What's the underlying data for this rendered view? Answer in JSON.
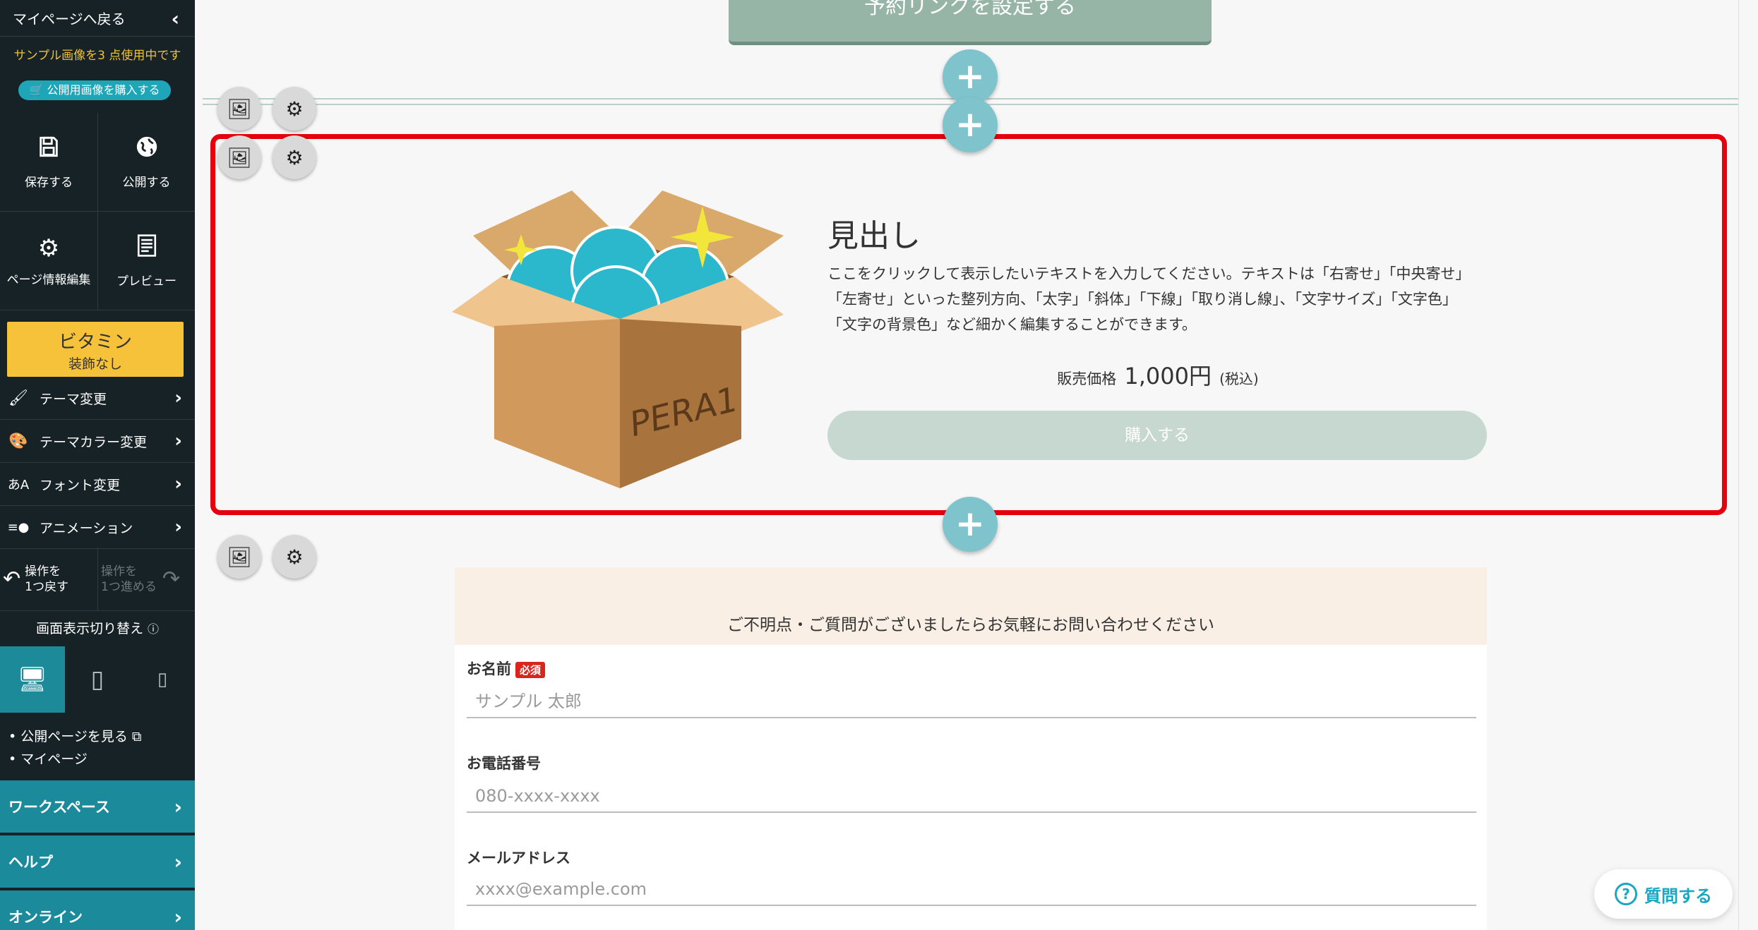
{
  "sidebar": {
    "back_label": "マイページへ戻る",
    "sample_notice": "サンプル画像を3 点使用中です",
    "buy_images_label": "公開用画像を購入する",
    "actions": [
      {
        "label": "保存する",
        "icon": "save-icon"
      },
      {
        "label": "公開する",
        "icon": "globe-icon"
      },
      {
        "label": "ページ情報編集",
        "icon": "gear-icon"
      },
      {
        "label": "プレビュー",
        "icon": "preview-icon"
      }
    ],
    "theme": {
      "name": "ビタミン",
      "sub": "装飾なし"
    },
    "menu": [
      {
        "label": "テーマ変更",
        "icon": "paint-roller-icon"
      },
      {
        "label": "テーマカラー変更",
        "icon": "palette-icon"
      },
      {
        "label": "フォント変更",
        "icon": "font-icon"
      },
      {
        "label": "アニメーション",
        "icon": "animation-icon"
      }
    ],
    "undo": {
      "line1": "操作を",
      "line2": "1つ戻す"
    },
    "redo": {
      "line1": "操作を",
      "line2": "1つ進める"
    },
    "view_switch_label": "画面表示切り替え",
    "links": [
      "公開ページを見る",
      "マイページ"
    ],
    "bottom": [
      {
        "label": "ワークスペース"
      },
      {
        "label": "ヘルプ"
      },
      {
        "label": "オンライン"
      }
    ]
  },
  "canvas": {
    "top_button_label": "予約リンクを設定する",
    "section": {
      "heading": "見出し",
      "body": "ここをクリックして表示したいテキストを入力してください。テキストは「右寄せ」「中央寄せ」「左寄せ」といった整列方向、「太字」「斜体」「下線」「取り消し線」、「文字サイズ」「文字色」「文字の背景色」など細かく編集することができます。",
      "price_label": "販売価格",
      "price_value": "1,000円",
      "price_tax": "(税込)",
      "buy_label": "購入する",
      "box_text": "PERA1"
    },
    "form": {
      "heading": "ご不明点・ご質問がございましたらお気軽にお問い合わせください",
      "fields": [
        {
          "label": "お名前",
          "required": "必須",
          "placeholder": "サンプル 太郎"
        },
        {
          "label": "お電話番号",
          "placeholder": "080-xxxx-xxxx"
        },
        {
          "label": "メールアドレス",
          "placeholder": "xxxx@example.com"
        }
      ]
    },
    "help_label": "質問する"
  },
  "colors": {
    "sidebar_bg": "#172226",
    "accent_teal": "#1b8b9b",
    "theme_yellow": "#f5c23a",
    "selection_red": "#e5000b",
    "plus_button": "#7fc4cd"
  }
}
